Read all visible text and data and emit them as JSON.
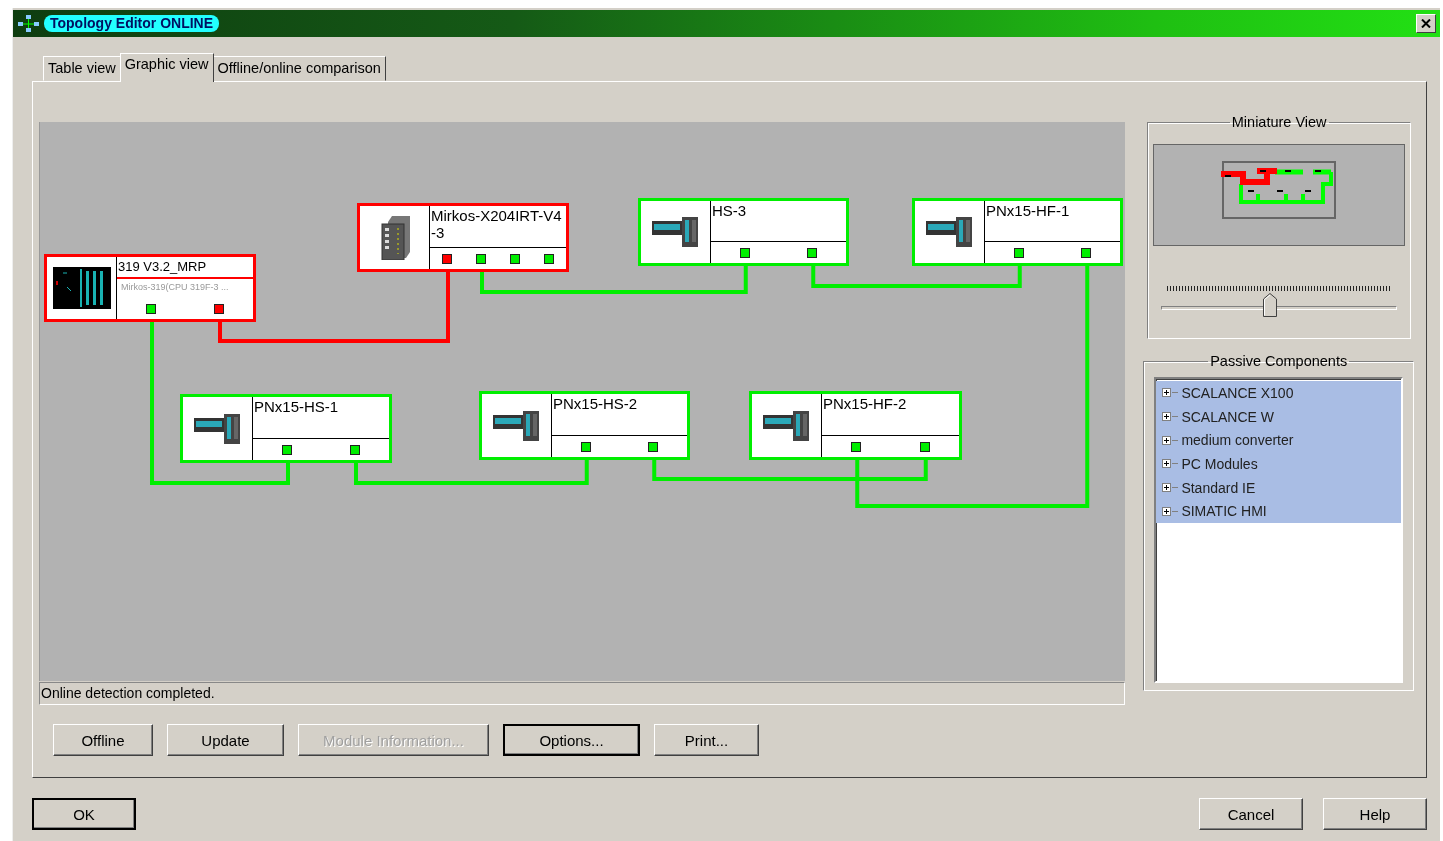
{
  "window": {
    "title": "Topology Editor  ONLINE"
  },
  "tabs": [
    {
      "label": "Table view",
      "selected": false
    },
    {
      "label": "Graphic view",
      "selected": true
    },
    {
      "label": "Offline/online comparison",
      "selected": false
    }
  ],
  "nodes": [
    {
      "name": "319 V3.2_MRP",
      "subtitle": "Mirkos-319(CPU 319F-3 ...",
      "kind": "cpu",
      "ports": [
        {
          "fault": false
        },
        {
          "fault": true
        }
      ]
    },
    {
      "name": "Mirkos-X204IRT-V4-3",
      "kind": "switch",
      "ports": [
        {
          "fault": true
        },
        {
          "fault": false
        },
        {
          "fault": false
        },
        {
          "fault": false
        }
      ]
    },
    {
      "name": "HS-3",
      "kind": "io",
      "ports": [
        {
          "fault": false
        },
        {
          "fault": false
        }
      ]
    },
    {
      "name": "PNx15-HF-1",
      "kind": "io",
      "ports": [
        {
          "fault": false
        },
        {
          "fault": false
        }
      ]
    },
    {
      "name": "PNx15-HS-1",
      "kind": "io",
      "ports": [
        {
          "fault": false
        },
        {
          "fault": false
        }
      ]
    },
    {
      "name": "PNx15-HS-2",
      "kind": "io",
      "ports": [
        {
          "fault": false
        },
        {
          "fault": false
        }
      ]
    },
    {
      "name": "PNx15-HF-2",
      "kind": "io",
      "ports": [
        {
          "fault": false
        },
        {
          "fault": false
        }
      ]
    }
  ],
  "status_bar": "Online detection completed.",
  "buttons": [
    {
      "label": "Offline",
      "disabled": false,
      "default": false
    },
    {
      "label": "Update",
      "disabled": false,
      "default": false
    },
    {
      "label": "Module Information...",
      "disabled": true,
      "default": false
    },
    {
      "label": "Options...",
      "disabled": false,
      "default": true
    },
    {
      "label": "Print...",
      "disabled": false,
      "default": false
    }
  ],
  "miniature": {
    "title": "Miniature View",
    "zoom": {
      "level": 0.46
    }
  },
  "passive_components": {
    "title": "Passive Components",
    "items": [
      {
        "label": "SCALANCE X100",
        "expanded": false,
        "selected": true
      },
      {
        "label": "SCALANCE W",
        "expanded": false,
        "selected": true
      },
      {
        "label": "medium converter",
        "expanded": false,
        "selected": true
      },
      {
        "label": "PC Modules",
        "expanded": false,
        "selected": true
      },
      {
        "label": "Standard IE",
        "expanded": false,
        "selected": true
      },
      {
        "label": "SIMATIC HMI",
        "expanded": false,
        "selected": true
      }
    ]
  },
  "dialog_buttons": [
    {
      "label": "OK"
    },
    {
      "label": "Cancel"
    },
    {
      "label": "Help"
    }
  ]
}
